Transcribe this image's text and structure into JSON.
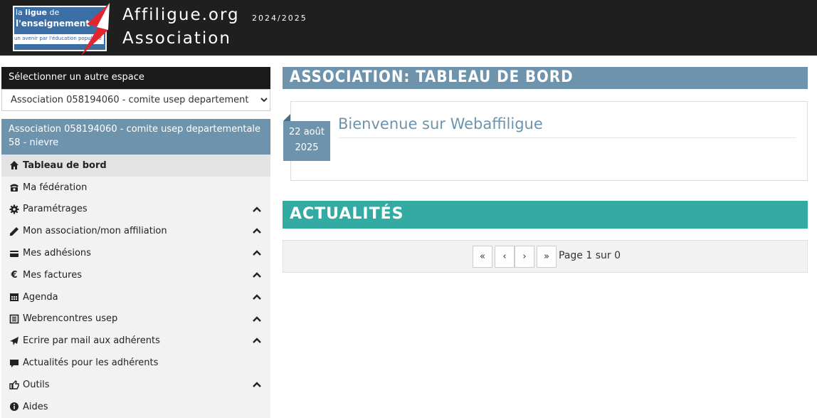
{
  "header": {
    "logo": {
      "line1_prefix": "la",
      "line1_bold": "ligue",
      "line1_suffix": "de",
      "line2": "l'enseignement",
      "tagline": "un avenir par l'éducation populaire"
    },
    "site_title": "Affiligue.org",
    "season": "2024/2025",
    "space_title": "Association"
  },
  "sidebar": {
    "switch_label": "Sélectionner un autre espace",
    "space_select_value": "Association 058194060 - comite usep departement",
    "association_name": "Association 058194060 - comite usep departementale 58 - nievre",
    "items": [
      {
        "label": "Tableau de bord",
        "icon": "home-icon",
        "expandable": false,
        "active": true
      },
      {
        "label": "Ma fédération",
        "icon": "phone-icon",
        "expandable": false,
        "active": false
      },
      {
        "label": "Paramétrages",
        "icon": "gear-icon",
        "expandable": true,
        "active": false
      },
      {
        "label": "Mon association/mon affiliation",
        "icon": "pencil-icon",
        "expandable": true,
        "active": false
      },
      {
        "label": "Mes adhésions",
        "icon": "card-icon",
        "expandable": true,
        "active": false
      },
      {
        "label": "Mes factures",
        "icon": "euro-icon",
        "expandable": true,
        "active": false
      },
      {
        "label": "Agenda",
        "icon": "calendar-icon",
        "expandable": true,
        "active": false
      },
      {
        "label": "Webrencontres usep",
        "icon": "list-icon",
        "expandable": true,
        "active": false
      },
      {
        "label": "Ecrire par mail aux adhérents",
        "icon": "send-icon",
        "expandable": true,
        "active": false
      },
      {
        "label": "Actualités pour les adhérents",
        "icon": "comment-icon",
        "expandable": false,
        "active": false
      },
      {
        "label": "Outils",
        "icon": "hand-pointer-icon",
        "expandable": true,
        "active": false
      },
      {
        "label": "Aides",
        "icon": "info-icon",
        "expandable": false,
        "active": false
      }
    ]
  },
  "main": {
    "dashboard_title": "ASSOCIATION: TABLEAU DE BORD",
    "welcome": {
      "date_line1": "22 août",
      "date_line2": "2025",
      "title": "Bienvenue sur Webaffiligue"
    },
    "news_title": "ACTUALITÉS",
    "pager": {
      "first": "«",
      "prev": "‹",
      "next": "›",
      "last": "»",
      "label": "Page 1 sur 0"
    }
  },
  "colors": {
    "header_bg": "#1f1f1f",
    "accent_blue": "#6e93ad",
    "accent_teal": "#33aba3",
    "logo_blue": "#3b6ea5",
    "logo_red": "#e3262e"
  }
}
